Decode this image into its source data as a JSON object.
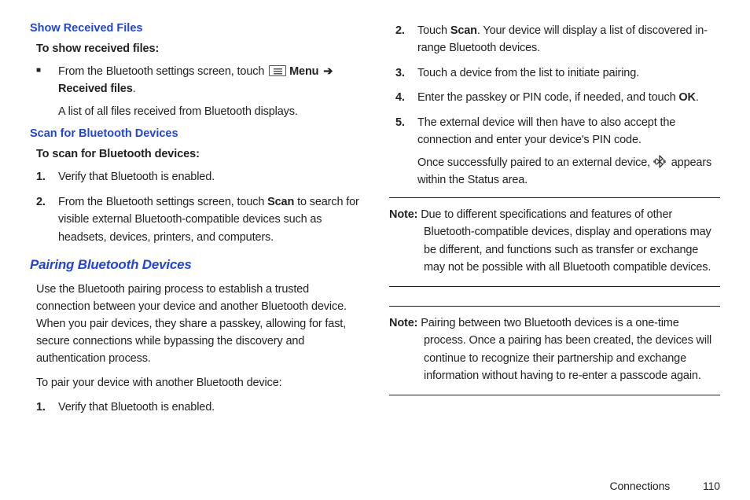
{
  "left": {
    "showReceived": {
      "heading": "Show Received Files",
      "intro": "To show received files:",
      "bullet": {
        "pre": "From the Bluetooth settings screen, touch ",
        "menuWord": "Menu",
        "arrow": "➔",
        "received": "Received files",
        "period": ".",
        "sub": "A list of all files received from Bluetooth displays."
      }
    },
    "scan": {
      "heading": "Scan for Bluetooth Devices",
      "intro": "To scan for Bluetooth devices:",
      "steps": [
        {
          "num": "1.",
          "text": "Verify that Bluetooth is enabled."
        },
        {
          "num": "2.",
          "pre": "From the Bluetooth settings screen, touch ",
          "bold": "Scan",
          "post": " to search for visible external Bluetooth-compatible devices such as headsets, devices, printers, and computers."
        }
      ]
    },
    "pairing": {
      "heading": "Pairing Bluetooth Devices",
      "para1": "Use the Bluetooth pairing process to establish a trusted connection between your device and another Bluetooth device. When you pair devices, they share a passkey, allowing for fast, secure connections while bypassing the discovery and authentication process.",
      "para2": "To pair your device with another Bluetooth device:",
      "steps": [
        {
          "num": "1.",
          "text": "Verify that Bluetooth is enabled."
        }
      ]
    }
  },
  "right": {
    "steps": [
      {
        "num": "2.",
        "pre": "Touch ",
        "bold": "Scan",
        "post": ". Your device will display a list of discovered in-range Bluetooth devices."
      },
      {
        "num": "3.",
        "text": "Touch a device from the list to initiate pairing."
      },
      {
        "num": "4.",
        "pre": "Enter the passkey or PIN code, if needed, and touch ",
        "bold": "OK",
        "post": "."
      },
      {
        "num": "5.",
        "text": "The external device will then have to also accept the connection and enter your device's PIN code.",
        "subPre": "Once successfully paired to an external device, ",
        "subPost": " appears within the Status area."
      }
    ],
    "note1": {
      "label": "Note:",
      "text": " Due to different specifications and features of other Bluetooth-compatible devices, display and operations may be different, and functions such as transfer or exchange may not be possible with all Bluetooth compatible devices."
    },
    "note2": {
      "label": "Note:",
      "text": " Pairing between two Bluetooth devices is a one-time process. Once a pairing has been created, the devices will continue to recognize their partnership and exchange information without having to re-enter a passcode again."
    }
  },
  "footer": {
    "section": "Connections",
    "page": "110"
  }
}
